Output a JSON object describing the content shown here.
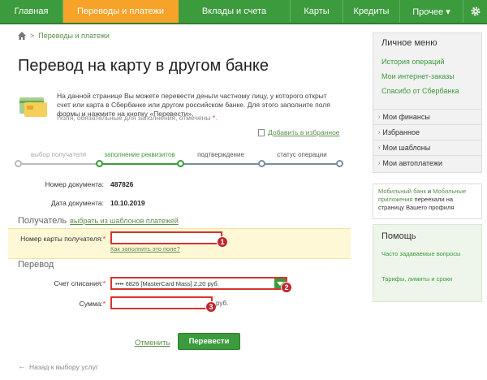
{
  "topnav": {
    "items": [
      "Главная",
      "Переводы и платежи",
      "Вклады и счета",
      "Карты",
      "Кредиты",
      "Прочее ▾"
    ],
    "active_index": 1,
    "gear_icon": "gear-icon",
    "colors": {
      "bar": "#3c9b3c",
      "active": "#f7a229"
    }
  },
  "breadcrumb": {
    "home_icon": "home-icon",
    "link": "Переводы и платежи"
  },
  "page": {
    "title": "Перевод на карту в другом банке",
    "intro": "На данной странице Вы можете перевести деньги частному лицу, у которого открыт счет или карта в Сбербанке или другом российском банке. Для этого заполните поля формы и нажмите на кнопку «Перевести».",
    "required_note": "Поля, обязательные для заполнения, отмечены",
    "required_star": "*",
    "favorite_link": "Добавить в избранное"
  },
  "steps": {
    "items": [
      "выбор получателя",
      "заполнение реквизитов",
      "подтверждение",
      "статус операции"
    ],
    "active_index": 1
  },
  "document": {
    "number_label": "Номер документа:",
    "number_value": "487826",
    "date_label": "Дата документа:",
    "date_value": "10.10.2019"
  },
  "recipient": {
    "section_title": "Получатель",
    "template_link": "выбрать из шаблонов платежей",
    "card_label": "Номер карты получателя:",
    "card_value": "",
    "help_link": "Как заполнить это поле?"
  },
  "transfer": {
    "section_title": "Перевод",
    "account_label": "Счет списания:",
    "account_value": "•••• 6826 [MasterCard Mass] 2,20 руб.",
    "amount_label": "Сумма:",
    "amount_value": "",
    "currency": "руб."
  },
  "badges": [
    "1",
    "2",
    "3"
  ],
  "actions": {
    "cancel": "Отменить",
    "submit": "Перевести"
  },
  "back_link": "Назад к выбору услуг",
  "sidebar": {
    "menu_title": "Личное меню",
    "links": [
      "История операций",
      "Мои интернет-заказы",
      "Спасибо от Сбербанка"
    ],
    "groups": [
      "Мои финансы",
      "Избранное",
      "Мои шаблоны",
      "Мои автоплатежи"
    ],
    "notice_link1": "Мобильный банк",
    "notice_and": " и ",
    "notice_link2": "Мобильные приложения",
    "notice_rest": " переехали на страницу Вашего профиля",
    "help_title": "Помощь",
    "help_items": [
      "Часто задаваемые вопросы",
      "Тарифы, лимиты и сроки"
    ]
  }
}
